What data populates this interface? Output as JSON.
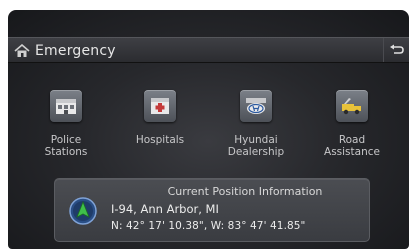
{
  "header": {
    "title": "Emergency"
  },
  "icons": {
    "home": "home-icon",
    "back": "back-arrow-icon",
    "navigation": "navigation-arrow-icon"
  },
  "tiles": [
    {
      "label": "Police\nStations",
      "icon": "police-station-icon"
    },
    {
      "label": "Hospitals",
      "icon": "hospital-icon"
    },
    {
      "label": "Hyundai\nDealership",
      "icon": "hyundai-dealership-icon"
    },
    {
      "label": "Road\nAssistance",
      "icon": "road-assistance-icon"
    }
  ],
  "position": {
    "title": "Current Position Information",
    "road": "I-94, Ann Arbor, MI",
    "coordinates": "N: 42° 17' 10.38\", W: 83° 47' 41.85\""
  },
  "colors": {
    "background": "#27282c",
    "text": "#e6e6e6",
    "nav_accent": "#2f9e3a"
  }
}
